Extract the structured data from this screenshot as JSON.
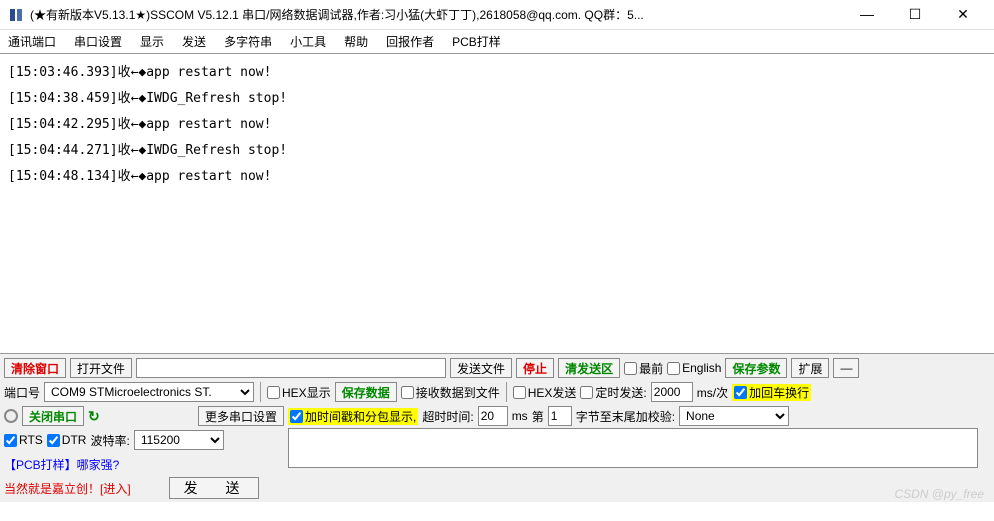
{
  "title": "(★有新版本V5.13.1★)SSCOM V5.12.1 串口/网络数据调试器,作者:习小猛(大虾丁丁),2618058@qq.com. QQ群：5...",
  "menu": [
    "通讯端口",
    "串口设置",
    "显示",
    "发送",
    "多字符串",
    "小工具",
    "帮助",
    "回报作者",
    "PCB打样"
  ],
  "log": [
    "[15:03:46.393]收←◆app restart now!",
    "[15:04:38.459]收←◆IWDG_Refresh stop!",
    "[15:04:42.295]收←◆app restart now!",
    "[15:04:44.271]收←◆IWDG_Refresh stop!",
    "[15:04:48.134]收←◆app restart now!"
  ],
  "row1": {
    "clear": "清除窗口",
    "open": "打开文件",
    "path": "",
    "sendfile": "发送文件",
    "stop": "停止",
    "clearsend": "清发送区",
    "top": "最前",
    "english": "English",
    "saveparam": "保存参数",
    "expand": "扩展"
  },
  "row2": {
    "portlabel": "端口号",
    "port": "COM9 STMicroelectronics ST.",
    "hexshow": "HEX显示",
    "savedata": "保存数据",
    "recvfile": "接收数据到文件",
    "hexsend": "HEX发送",
    "timed": "定时发送:",
    "interval": "2000",
    "unit": "ms/次",
    "addcrlf": "加回车换行"
  },
  "row3": {
    "close": "关闭串口",
    "more": "更多串口设置",
    "timestamp": "加时间戳和分包显示,",
    "timeout_lbl": "超时时间:",
    "timeout": "20",
    "ms": "ms",
    "nth_lbl": "第",
    "nth": "1",
    "crc_lbl": "字节至末尾加校验:",
    "crc": "None"
  },
  "row4": {
    "rts": "RTS",
    "dtr": "DTR",
    "baud_lbl": "波特率:",
    "baud": "115200",
    "sendtext": ""
  },
  "row5": {
    "ad1": "【PCB打样】哪家强?",
    "ad2": "当然就是嘉立创！[进入]",
    "send": "发 送"
  },
  "watermark": "CSDN @py_free"
}
